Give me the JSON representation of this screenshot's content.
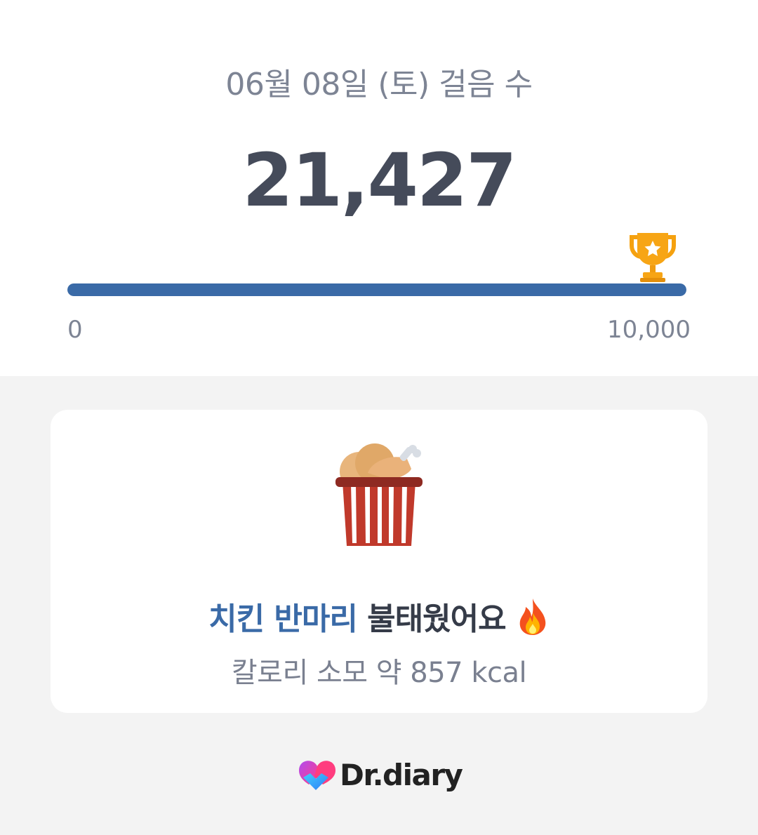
{
  "header": {
    "date_title": "06월 08일 (토) 걸음 수",
    "step_count": "21,427"
  },
  "progress": {
    "min_label": "0",
    "max_label": "10,000",
    "fraction": 1.0,
    "bar_color": "#3a6aa7",
    "goal_icon": "trophy-icon"
  },
  "summary": {
    "food_icon": "chicken-bucket-icon",
    "highlight": "치킨 반마리",
    "rest": " 불태웠어요 ",
    "emoji_icon": "fire-icon",
    "calorie_text": "칼로리 소모 약 857 kcal",
    "accent_color": "#3a6aa7"
  },
  "brand": {
    "logo_icon": "heart-logo-icon",
    "name": "Dr.diary"
  }
}
